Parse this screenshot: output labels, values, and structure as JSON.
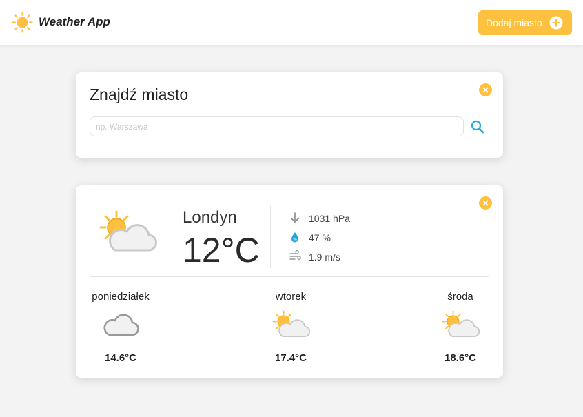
{
  "header": {
    "logo_icon": "sun-icon",
    "app_name": "Weather App",
    "add_city_label": "Dodaj miasto",
    "add_city_icon": "plus-circle-icon",
    "accent_color": "#fdc13f"
  },
  "search": {
    "title": "Znajdź miasto",
    "placeholder": "np. Warszawa",
    "value": "",
    "search_icon": "search-icon",
    "close_icon": "close-icon"
  },
  "weather": {
    "city": "Londyn",
    "temperature": "12°C",
    "condition_icon": "partly-cloudy-icon",
    "pressure": "1031 hPa",
    "pressure_icon": "arrow-down-icon",
    "humidity": "47 %",
    "humidity_icon": "water-drop-icon",
    "wind": "1.9 m/s",
    "wind_icon": "wind-icon",
    "forecast": [
      {
        "day": "poniedziałek",
        "temp": "14.6°C",
        "icon": "cloud-icon"
      },
      {
        "day": "wtorek",
        "temp": "17.4°C",
        "icon": "partly-cloudy-icon"
      },
      {
        "day": "środa",
        "temp": "18.6°C",
        "icon": "partly-cloudy-icon"
      }
    ]
  }
}
